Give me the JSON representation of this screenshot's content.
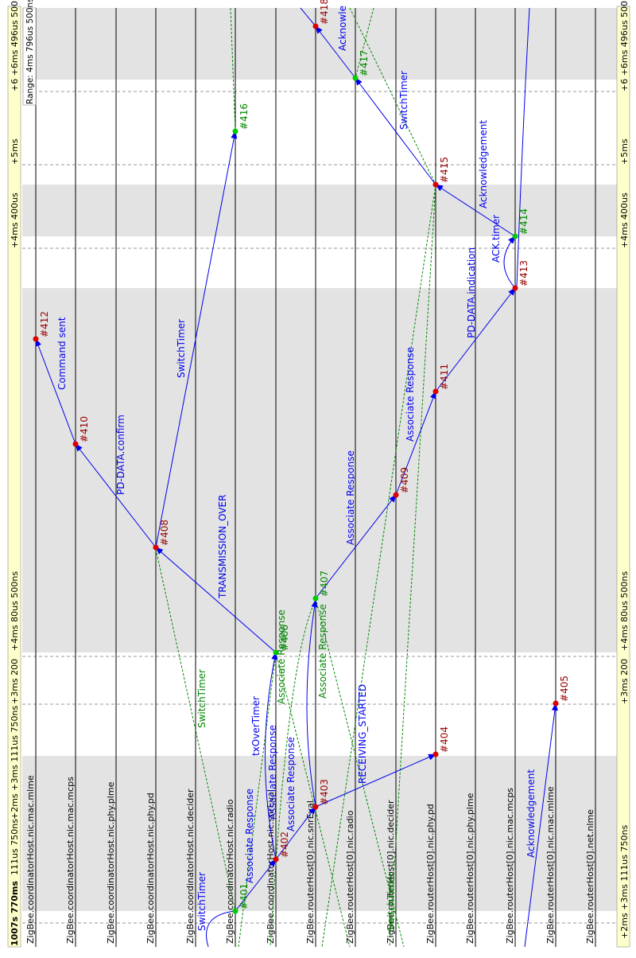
{
  "header": {
    "sim_time": "1007s 770ms",
    "sim_time_offset": "111us 750ns",
    "range_label": "Range: 4ms 796us 500ns"
  },
  "time_ticks": [
    {
      "label": "+2ms +3ms 111us 750ns"
    },
    {
      "label": "+3ms 200"
    },
    {
      "label": "+4ms 80us 500ns"
    },
    {
      "label": "+4ms 400us"
    },
    {
      "label": "+5ms"
    },
    {
      "label": "+6 +6ms 496us 500ns"
    }
  ],
  "axes": [
    "ZigBee.coordinatorHost.nic.mac.mlme",
    "ZigBee.coordinatorHost.nic.mac.mcps",
    "ZigBee.coordinatorHost.nic.phy.plme",
    "ZigBee.coordinatorHost.nic.phy.pd",
    "ZigBee.coordinatorHost.nic.decider",
    "ZigBee.coordinatorHost.nic.radio",
    "ZigBee.coordinatorHost.nic.snrEval",
    "ZigBee.routerHost[0].nic.snrEval",
    "ZigBee.routerHost[0].nic.radio",
    "ZigBee.routerHost[0].nic.decider",
    "ZigBee.routerHost[0].nic.phy.pd",
    "ZigBee.routerHost[0].nic.phy.plme",
    "ZigBee.routerHost[0].nic.mac.mcps",
    "ZigBee.routerHost[0].nic.mac.mlme",
    "ZigBee.routerHost[0].net.nlme"
  ],
  "events": [
    {
      "id": "#401"
    },
    {
      "id": "#402"
    },
    {
      "id": "#403"
    },
    {
      "id": "#404"
    },
    {
      "id": "#405"
    },
    {
      "id": "#406"
    },
    {
      "id": "#407"
    },
    {
      "id": "#408"
    },
    {
      "id": "#409"
    },
    {
      "id": "#410"
    },
    {
      "id": "#411"
    },
    {
      "id": "#412"
    },
    {
      "id": "#413"
    },
    {
      "id": "#414"
    },
    {
      "id": "#415"
    },
    {
      "id": "#416"
    },
    {
      "id": "#417"
    },
    {
      "id": "#418"
    }
  ],
  "messages": [
    "Associate Response",
    "Associate Response",
    "Associate Response",
    "Associate Response",
    "Associate Response",
    "Associate Response",
    "TRANSMISSION_OVER",
    "RECEIVING_STARTED",
    "PD-DATA.confirm",
    "Command sent",
    "PD-DATA.indication",
    "ACK.timer",
    "Acknowledgement",
    "Acknowledgement",
    "SwitchTimer",
    "SwitchTimer",
    "SwitchTimer",
    "SwitchTimer",
    "txOverTimer",
    "Acknowle",
    "Associate Response",
    "SwitchTimer"
  ],
  "colors": {
    "ruler_bg": "#ffffcc",
    "band_gray": "#e3e3e3",
    "axis_line": "#000000",
    "msg_blue": "#0000ee",
    "msg_green": "#008800",
    "event_red": "#dd0000",
    "event_green": "#00cc00",
    "label_red": "#990000"
  }
}
